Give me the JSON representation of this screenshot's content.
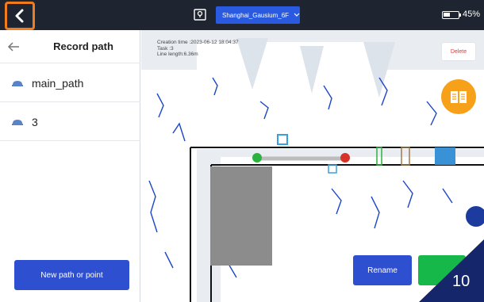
{
  "topbar": {
    "map_name": "Shanghai_Gausium_6F",
    "battery": "45%",
    "battery_level": 0.45
  },
  "left_panel": {
    "title": "Record path",
    "paths": [
      {
        "label": "main_path"
      },
      {
        "label": "3"
      }
    ],
    "new_button_label": "New path or point"
  },
  "map": {
    "info": {
      "creation_time": "Creation time :2023-06-12 18:04:37",
      "task": "Task :3",
      "line_length": "Line length:6.36m"
    },
    "delete_label": "Delete",
    "rename_label": "Rename"
  },
  "badge": {
    "number": "10"
  },
  "colors": {
    "topbar": "#1e2430",
    "accent_blue": "#2e4fd0",
    "highlight_orange": "#f07c1e",
    "book_orange": "#f7a11b",
    "confirm_green": "#16b84a",
    "badge_navy": "#16266b",
    "delete_red": "#e23b3b"
  }
}
